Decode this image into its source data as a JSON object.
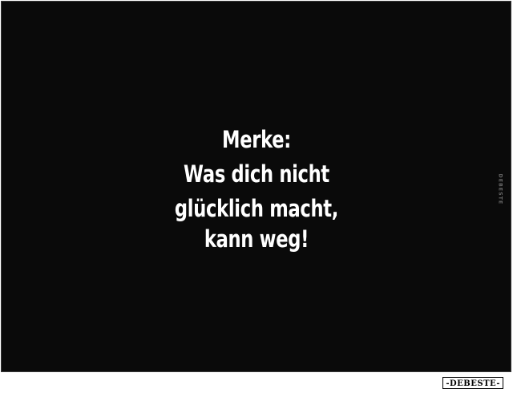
{
  "quote": {
    "heading": "Merke:",
    "lines": [
      "Was dich nicht",
      "glücklich macht,",
      "kann weg!"
    ]
  },
  "watermark": {
    "side_text": "DEBESTE",
    "badge_text": "-DEBESTE-"
  },
  "colors": {
    "background": "#0a0a0a",
    "text": "#ffffff",
    "page": "#ffffff"
  }
}
